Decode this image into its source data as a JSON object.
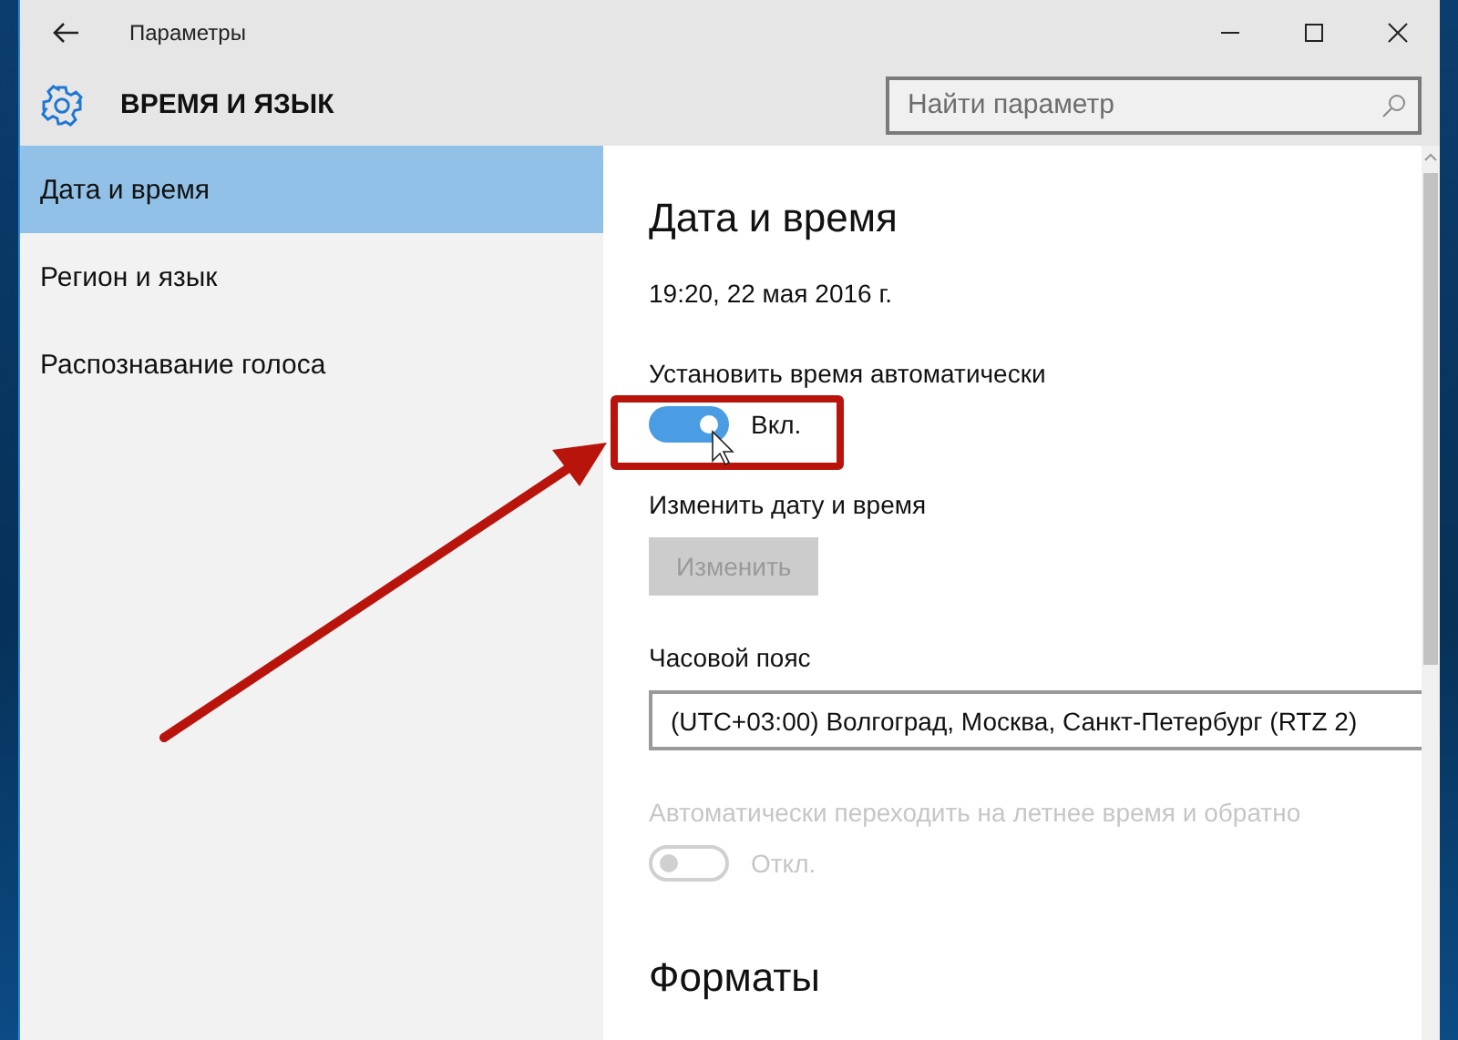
{
  "window": {
    "title": "Параметры"
  },
  "header": {
    "title": "ВРЕМЯ И ЯЗЫК",
    "search": {
      "placeholder": "Найти параметр"
    }
  },
  "sidebar": {
    "items": [
      {
        "label": "Дата и время",
        "selected": true
      },
      {
        "label": "Регион и язык",
        "selected": false
      },
      {
        "label": "Распознавание голоса",
        "selected": false
      }
    ]
  },
  "content": {
    "heading": "Дата и время",
    "current_datetime": "19:20, 22 мая 2016 г.",
    "settings": [
      {
        "kind": "toggle",
        "label": "Установить время автоматически",
        "on": true,
        "disabled": false,
        "state_text": "Вкл."
      },
      {
        "kind": "button",
        "label": "Изменить дату и время",
        "button": "Изменить",
        "disabled": true
      },
      {
        "kind": "dropdown",
        "label": "Часовой пояс",
        "value": "(UTC+03:00) Волгоград, Москва, Санкт-Петербург (RTZ 2)"
      },
      {
        "kind": "toggle",
        "label": "Автоматически переходить на летнее время и обратно",
        "on": false,
        "disabled": true,
        "state_text": "Откл."
      }
    ],
    "section_heading": "Форматы"
  }
}
